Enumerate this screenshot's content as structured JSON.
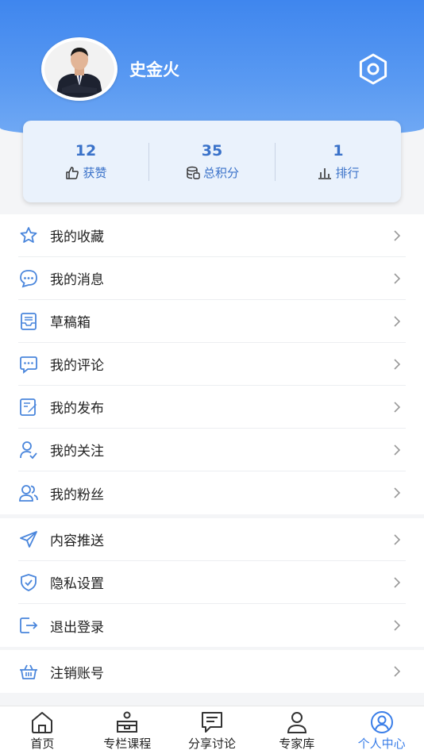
{
  "profile": {
    "name": "史金火"
  },
  "stats": [
    {
      "value": "12",
      "label": "获赞",
      "icon": "thumbs-up-icon"
    },
    {
      "value": "35",
      "label": "总积分",
      "icon": "coins-icon"
    },
    {
      "value": "1",
      "label": "排行",
      "icon": "bar-chart-icon"
    }
  ],
  "menu_group1": [
    {
      "label": "我的收藏",
      "icon": "star-icon"
    },
    {
      "label": "我的消息",
      "icon": "message-icon"
    },
    {
      "label": "草稿箱",
      "icon": "inbox-icon"
    },
    {
      "label": "我的评论",
      "icon": "comment-icon"
    },
    {
      "label": "我的发布",
      "icon": "edit-icon"
    },
    {
      "label": "我的关注",
      "icon": "follow-icon"
    },
    {
      "label": "我的粉丝",
      "icon": "fans-icon"
    }
  ],
  "menu_group2": [
    {
      "label": "内容推送",
      "icon": "send-icon"
    },
    {
      "label": "隐私设置",
      "icon": "shield-icon"
    },
    {
      "label": "退出登录",
      "icon": "logout-icon"
    }
  ],
  "menu_group3": [
    {
      "label": "注销账号",
      "icon": "basket-icon"
    }
  ],
  "tabbar": [
    {
      "label": "首页",
      "icon": "home-icon",
      "active": false
    },
    {
      "label": "专栏课程",
      "icon": "course-icon",
      "active": false
    },
    {
      "label": "分享讨论",
      "icon": "discussion-icon",
      "active": false
    },
    {
      "label": "专家库",
      "icon": "expert-icon",
      "active": false
    },
    {
      "label": "个人中心",
      "icon": "user-center-icon",
      "active": true
    }
  ],
  "colors": {
    "accent": "#3a72c9",
    "header": "#4a8df0",
    "active_tab": "#3a7ee8"
  }
}
